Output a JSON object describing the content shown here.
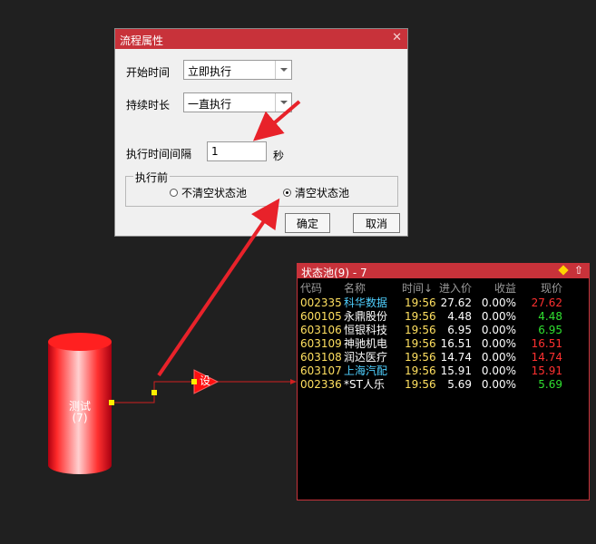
{
  "dialog": {
    "title": "流程属性",
    "start_time_label": "开始时间",
    "start_time_value": "立即执行",
    "duration_label": "持续时长",
    "duration_value": "一直执行",
    "interval_label": "执行时间间隔",
    "interval_value": "1",
    "interval_unit": "秒",
    "group_label": "执行前",
    "radio_keep": "不清空状态池",
    "radio_clear": "清空状态池",
    "selected_radio": "清空状态池",
    "ok_label": "确定",
    "cancel_label": "取消",
    "close_icon": "close-icon"
  },
  "flow": {
    "source_name": "测试",
    "source_count": "(7)",
    "node_label": "设"
  },
  "pool": {
    "title": "状态池(9) - 7",
    "columns": [
      "代码",
      "名称",
      "时间↓",
      "进入价",
      "收益",
      "现价"
    ],
    "rows": [
      {
        "code": "002335",
        "name": "科华数据",
        "time": "19:56",
        "entry": "27.62",
        "gain": "0.00%",
        "price": "27.62",
        "name_color": "#4fd0ff",
        "price_color": "#ff3030"
      },
      {
        "code": "600105",
        "name": "永鼎股份",
        "time": "19:56",
        "entry": "4.48",
        "gain": "0.00%",
        "price": "4.48",
        "name_color": "#ffffff",
        "price_color": "#30e030"
      },
      {
        "code": "603106",
        "name": "恒银科技",
        "time": "19:56",
        "entry": "6.95",
        "gain": "0.00%",
        "price": "6.95",
        "name_color": "#ffffff",
        "price_color": "#30e030"
      },
      {
        "code": "603109",
        "name": "神驰机电",
        "time": "19:56",
        "entry": "16.51",
        "gain": "0.00%",
        "price": "16.51",
        "name_color": "#ffffff",
        "price_color": "#ff3030"
      },
      {
        "code": "603108",
        "name": "润达医疗",
        "time": "19:56",
        "entry": "14.74",
        "gain": "0.00%",
        "price": "14.74",
        "name_color": "#ffffff",
        "price_color": "#ff3030"
      },
      {
        "code": "603107",
        "name": "上海汽配",
        "time": "19:56",
        "entry": "15.91",
        "gain": "0.00%",
        "price": "15.91",
        "name_color": "#4fd0ff",
        "price_color": "#ff3030"
      },
      {
        "code": "002336",
        "name": "*ST人乐",
        "time": "19:56",
        "entry": "5.69",
        "gain": "0.00%",
        "price": "5.69",
        "name_color": "#ffffff",
        "price_color": "#30e030"
      }
    ]
  },
  "colors": {
    "accent": "#c8323a",
    "code": "#ffe060",
    "up": "#ff3030",
    "down": "#30e030",
    "arrow": "#e8222a"
  }
}
